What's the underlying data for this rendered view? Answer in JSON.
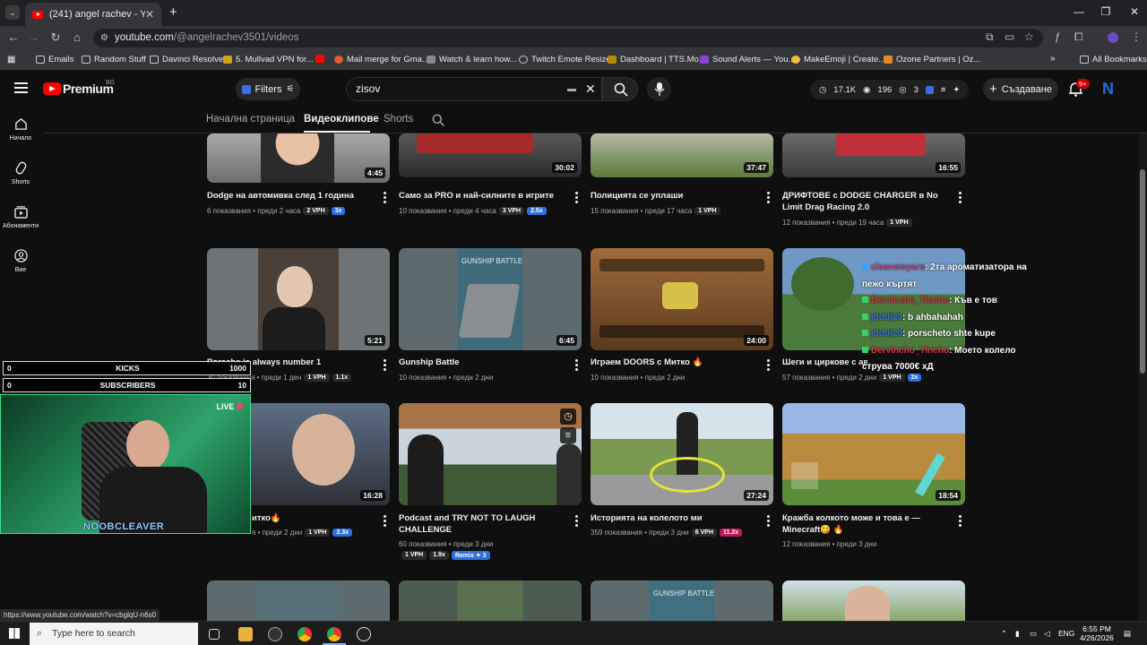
{
  "browser": {
    "tab_title": "(241) angel rachev - YouTube",
    "url_host": "youtube.com",
    "url_path": "/@angelrachev3501/videos",
    "bookmarks": [
      "Emails",
      "Random Stuff",
      "Davinci Resolve",
      "5. Mullvad VPN for...",
      "Mail merge for Gma...",
      "Watch & learn how...",
      "Twitch Emote Resizer",
      "Dashboard | TTS.Mo...",
      "Sound Alerts — You...",
      "MakeEmoji | Create...",
      "Ozone Partners | Oz..."
    ],
    "all_bookmarks": "All Bookmarks"
  },
  "youtube": {
    "logo_text": "Premium",
    "country": "BG",
    "filters_label": "Filters",
    "search_value": "zisov",
    "stats": {
      "views": "17.1K",
      "likes": "196",
      "viewers": "3"
    },
    "create_label": "Създаване",
    "notif_count": "9+",
    "avatar_letter": "N"
  },
  "rail": [
    {
      "label": "Начало",
      "icon": "home-icon"
    },
    {
      "label": "Shorts",
      "icon": "shorts-icon"
    },
    {
      "label": "Абонаменти",
      "icon": "subscriptions-icon"
    },
    {
      "label": "Вие",
      "icon": "you-icon"
    }
  ],
  "channel_tabs": [
    "Начална страница",
    "Видеоклипове",
    "Shorts"
  ],
  "videos": [
    {
      "title": "Dodge на автомивка след 1 година",
      "meta": "6 показвания • преди 2 часа",
      "badges": [
        "2 VPH",
        "3x"
      ],
      "duration": "4:45"
    },
    {
      "title": "Само за PRO и най-силните в игрите",
      "meta": "10 показвания • преди 4 часа",
      "badges": [
        "3 VPH",
        "2.5x"
      ],
      "duration": "30:02"
    },
    {
      "title": "Полицията се уплаши",
      "meta": "15 показвания • преди 17 часа",
      "badges": [
        "1 VPH"
      ],
      "duration": "37:47"
    },
    {
      "title": "ДРИФТОВЕ с DODGE CHARGER в No Limit Drag Racing 2.0",
      "meta": "12 показвания • преди 19 часа",
      "badges": [
        "1 VPH"
      ],
      "duration": "16:55"
    },
    {
      "title": "Porsche is always number 1",
      "meta": "30 показвания • преди 1 ден",
      "badges": [
        "1 VPH",
        "1.1x"
      ],
      "duration": "5:21"
    },
    {
      "title": "Gunship Battle",
      "meta": "10 показвания • преди 2 дни",
      "badges": [],
      "duration": "6:45"
    },
    {
      "title": "Играем DOORS с Митко 🔥",
      "meta": "10 показвания • преди 2 дни",
      "badges": [],
      "duration": "24:00"
    },
    {
      "title": "Шеги и циркове с авес",
      "meta": "57 показвания • преди 2 дни",
      "badges": [
        "1 VPH",
        "2x"
      ],
      "duration": ""
    },
    {
      "title": "итко🔥",
      "meta": "я • преди 2 дни",
      "badges": [
        "1 VPH",
        "2.3x"
      ],
      "duration": "16:28"
    },
    {
      "title": "Podcast and TRY NOT TO LAUGH CHALLENGE",
      "meta": "60 показвания • преди 3 дни",
      "badges": [
        "1 VPH",
        "1.9x",
        "Remix ✦ 3"
      ],
      "duration": ""
    },
    {
      "title": "Историята на колелото ми",
      "meta": "359 показвания • преди 3 дни",
      "badges": [
        "6 VPH",
        "11.2x"
      ],
      "duration": "27:24"
    },
    {
      "title": "Кражба колкото може и това е — Minecraft😋 🔥",
      "meta": "12 показвания • преди 3 дни",
      "badges": [],
      "duration": "18:54"
    }
  ],
  "overlay": {
    "kicks": {
      "left": "0",
      "label": "KICKS",
      "right": "1000"
    },
    "subs": {
      "left": "0",
      "label": "SUBSCRIBERS",
      "right": "10"
    },
    "live": "LIVE",
    "streamer": "NOOBCLEAVER"
  },
  "chat": [
    {
      "name": "cleavemyars",
      "text": ": 2та ароматизатора на пежо кърт​ят"
    },
    {
      "name": "Dervincho_Tincho",
      "text": ": Къв е тов"
    },
    {
      "name": "jdddj23",
      "text": ": b ahbahahah"
    },
    {
      "name": "jdddj23",
      "text": ": porscheto shte kupe"
    },
    {
      "name": "Dervincho_Tincho",
      "text": ": Моето колело струва 7000€ хД"
    }
  ],
  "status_url": "https://www.youtube.com/watch?v=cbglqU-n6s0",
  "taskbar": {
    "search_placeholder": "Type here to search",
    "lang": "ENG",
    "time": "6:55 PM",
    "date": "4/26/2026"
  }
}
